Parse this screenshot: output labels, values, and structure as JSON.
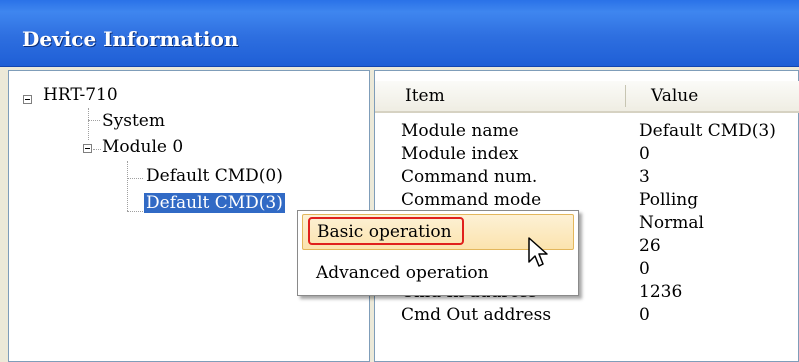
{
  "window": {
    "title": "Device Information"
  },
  "tree": {
    "root": "HRT-710",
    "system": "System",
    "module": "Module 0",
    "cmd0": "Default CMD(0)",
    "cmd3": "Default CMD(3)"
  },
  "list": {
    "headers": {
      "item": "Item",
      "value": "Value"
    },
    "rows": [
      {
        "item": "Module name",
        "value": "Default CMD(3)"
      },
      {
        "item": "Module index",
        "value": "0"
      },
      {
        "item": "Command num.",
        "value": "3"
      },
      {
        "item": "Command mode",
        "value": "Polling"
      },
      {
        "item": "",
        "value": "Normal"
      },
      {
        "item": "",
        "value": "26"
      },
      {
        "item": "",
        "value": "0"
      },
      {
        "item": "Cmd In address",
        "value": "1236"
      },
      {
        "item": "Cmd Out address",
        "value": "0"
      }
    ]
  },
  "context_menu": {
    "items": [
      {
        "label": "Basic operation"
      },
      {
        "label": "Advanced operation"
      }
    ]
  },
  "colors": {
    "titlebar": "#2e6fe0",
    "selection": "#316ac5",
    "highlight_border": "#e0201c"
  }
}
